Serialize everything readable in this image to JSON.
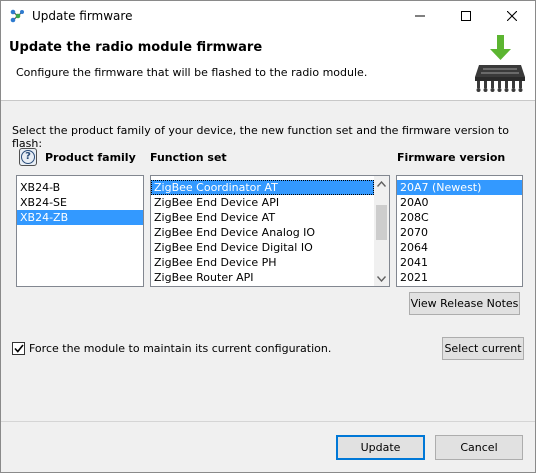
{
  "window": {
    "title": "Update firmware"
  },
  "banner": {
    "title": "Update the radio module firmware",
    "subtitle": "Configure the firmware that will be flashed to the radio module."
  },
  "instruction": "Select the product family of your device, the new function set and the firmware version to flash:",
  "columns": {
    "product_family": "Product family",
    "function_set": "Function set",
    "firmware_version": "Firmware version"
  },
  "product_family": {
    "items": [
      "XB24-B",
      "XB24-SE",
      "XB24-ZB"
    ],
    "selected_index": 2
  },
  "function_set": {
    "items": [
      "ZigBee Coordinator AT",
      "ZigBee End Device API",
      "ZigBee End Device AT",
      "ZigBee End Device Analog IO",
      "ZigBee End Device Digital IO",
      "ZigBee End Device PH",
      "ZigBee Router API"
    ],
    "selected_index": 0
  },
  "firmware_version": {
    "items": [
      "20A7 (Newest)",
      "20A0",
      "208C",
      "2070",
      "2064",
      "2041",
      "2021"
    ],
    "selected_index": 0
  },
  "buttons": {
    "view_release_notes": "View Release Notes",
    "select_current": "Select current",
    "update": "Update",
    "cancel": "Cancel"
  },
  "force_config": {
    "label": "Force the module to maintain its current configuration.",
    "checked": true
  },
  "colors": {
    "selection": "#3399ff",
    "default_button_border": "#0078d7",
    "icon_green": "#5cb531"
  }
}
